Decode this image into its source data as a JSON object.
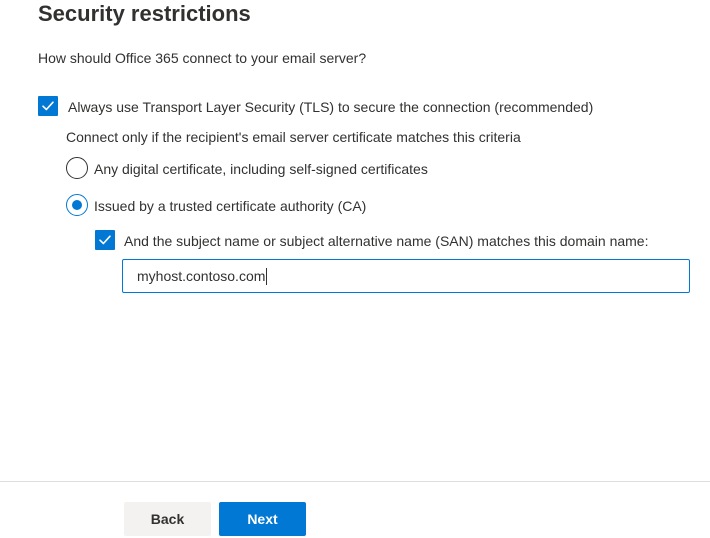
{
  "header": {
    "title": "Security restrictions"
  },
  "question": "How should Office 365 connect to your email server?",
  "tls_option": {
    "label": "Always use Transport Layer Security (TLS) to secure the connection (recommended)",
    "checked": true
  },
  "criteria_label": "Connect only if the recipient's email server certificate matches this criteria",
  "certificate_options": [
    {
      "label": "Any digital certificate, including self-signed certificates",
      "selected": false
    },
    {
      "label": "Issued by a trusted certificate authority (CA)",
      "selected": true
    }
  ],
  "san_option": {
    "label": "And the subject name or subject alternative name (SAN) matches this domain name:",
    "checked": true
  },
  "domain_input": {
    "value": "myhost.contoso.com"
  },
  "footer": {
    "back_label": "Back",
    "next_label": "Next"
  },
  "colors": {
    "accent": "#0078d4",
    "text": "#323130",
    "secondary_button": "#f3f2f1"
  },
  "icons": {
    "checkbox_checked": "checkmark-icon",
    "radio_selected": "radio-dot"
  }
}
